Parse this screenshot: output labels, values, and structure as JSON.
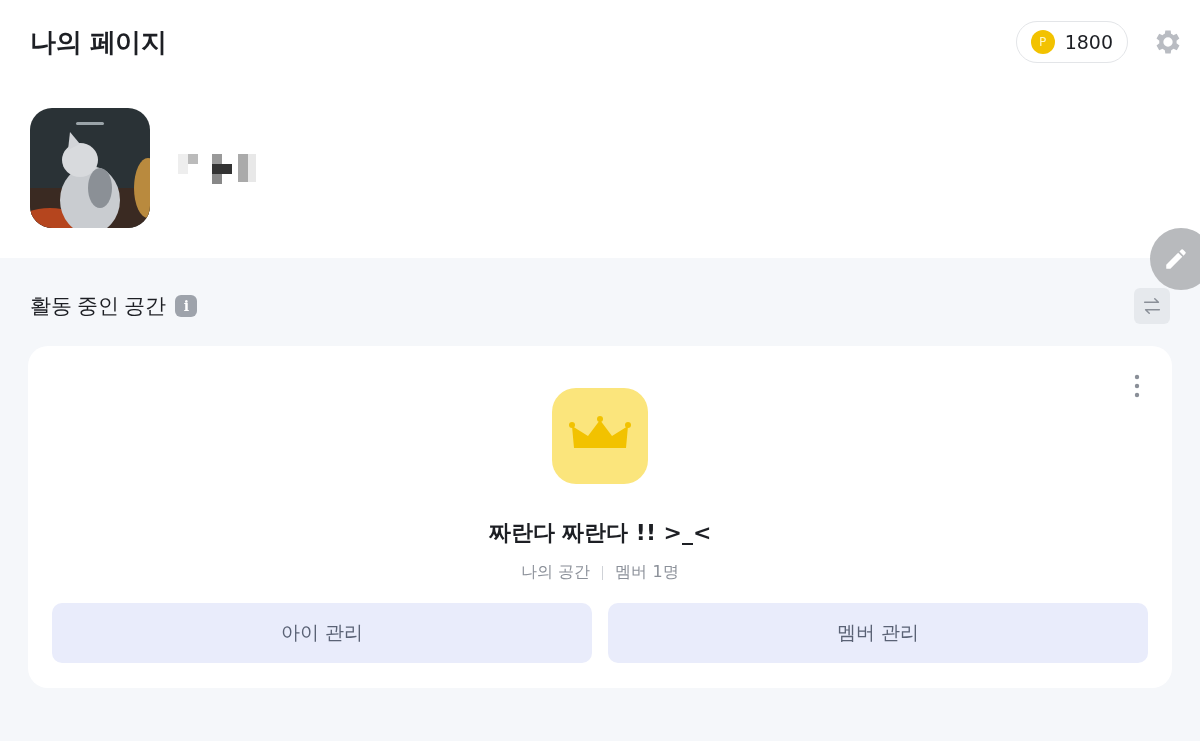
{
  "header": {
    "title": "나의 페이지",
    "points": "1800",
    "point_symbol": "P"
  },
  "spaces": {
    "title": "활동 중인 공간",
    "info_symbol": "i",
    "card": {
      "name": "짜란다 짜란다 !! >_<",
      "type": "나의 공간",
      "members": "멤버 1명",
      "buttons": [
        {
          "label": "아이 관리"
        },
        {
          "label": "멤버 관리"
        }
      ]
    }
  }
}
